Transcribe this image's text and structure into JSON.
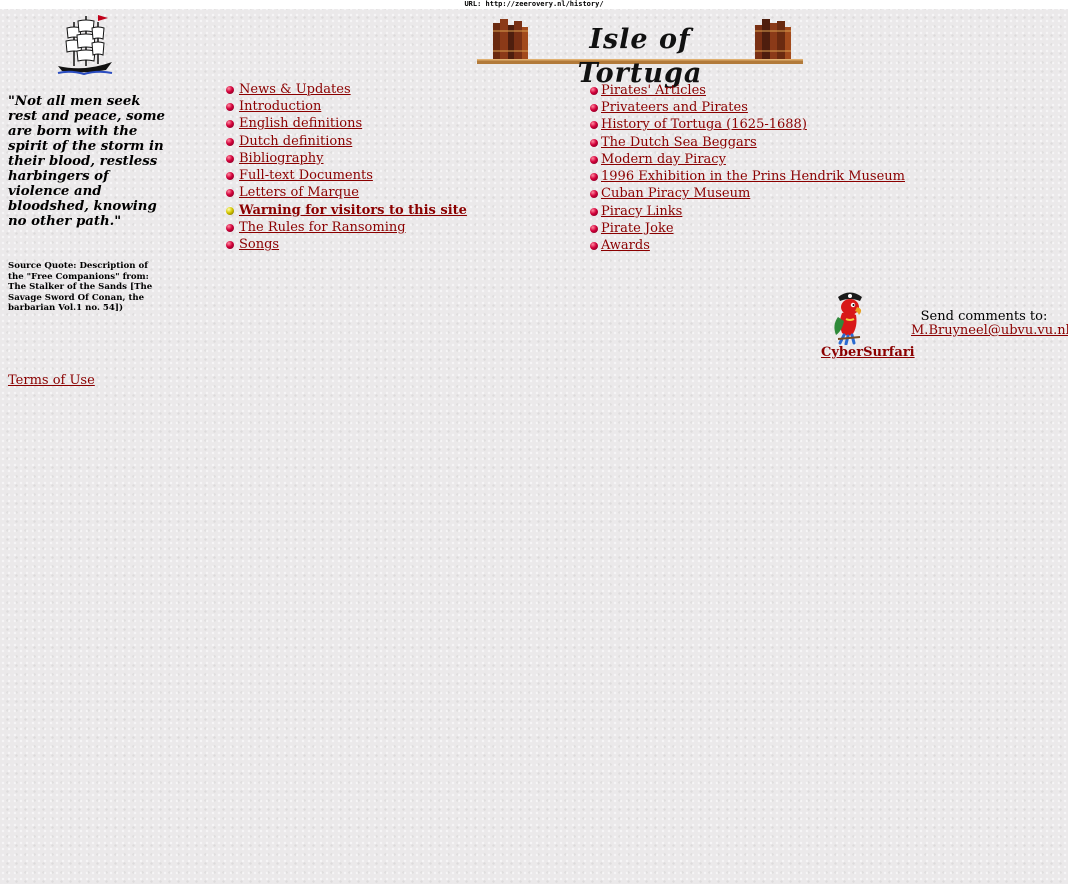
{
  "url_bar": {
    "text": "URL: http://zeerovery.nl/history/"
  },
  "header": {
    "banner_title": "Isle of Tortuga",
    "banner_icon": "bookshelf-icon",
    "logo_icon": "sailing-ship-icon"
  },
  "sidebar": {
    "quote": "\"Not all men seek rest and peace, some are born with the spirit of the storm in their blood, restless harbingers of violence and bloodshed, knowing no other path.\"",
    "source": "Source Quote: Description of the \"Free Companions\" from: The Stalker of the Sands [The Savage Sword Of Conan, the barbarian Vol.1 no. 54])",
    "terms_link": "Terms of Use"
  },
  "nav_left": [
    {
      "label": "News & Updates",
      "bullet": "red"
    },
    {
      "label": "Introduction",
      "bullet": "red"
    },
    {
      "label": "English definitions",
      "bullet": "red"
    },
    {
      "label": "Dutch definitions",
      "bullet": "red"
    },
    {
      "label": "Bibliography",
      "bullet": "red"
    },
    {
      "label": "Full-text Documents",
      "bullet": "red"
    },
    {
      "label": "Letters of Marque",
      "bullet": "red"
    },
    {
      "label": "Warning for visitors to this site",
      "bullet": "yellow"
    },
    {
      "label": "The Rules for Ransoming",
      "bullet": "red"
    },
    {
      "label": "Songs",
      "bullet": "red"
    }
  ],
  "nav_right": [
    {
      "label": "Pirates' Articles",
      "bullet": "red"
    },
    {
      "label": "Privateers and Pirates",
      "bullet": "red"
    },
    {
      "label": "History of Tortuga (1625-1688)",
      "bullet": "red"
    },
    {
      "label": "The Dutch Sea Beggars",
      "bullet": "red"
    },
    {
      "label": "Modern day Piracy",
      "bullet": "red"
    },
    {
      "label": "1996 Exhibition in the Prins Hendrik Museum",
      "bullet": "red"
    },
    {
      "label": "Cuban Piracy Museum",
      "bullet": "red"
    },
    {
      "label": "Piracy Links",
      "bullet": "red"
    },
    {
      "label": "Pirate Joke",
      "bullet": "red"
    },
    {
      "label": "Awards",
      "bullet": "red"
    }
  ],
  "footer": {
    "mascot_label": "CyberSurfari",
    "mascot_icon": "parrot-pirate-icon",
    "comments_label": "Send comments to:",
    "email": "M.Bruyneel@ubvu.vu.nl"
  },
  "colors": {
    "link": "#8b0000",
    "background": "#ebe9ea",
    "bullet_red": "#d3003a",
    "bullet_yellow": "#d6c800"
  }
}
